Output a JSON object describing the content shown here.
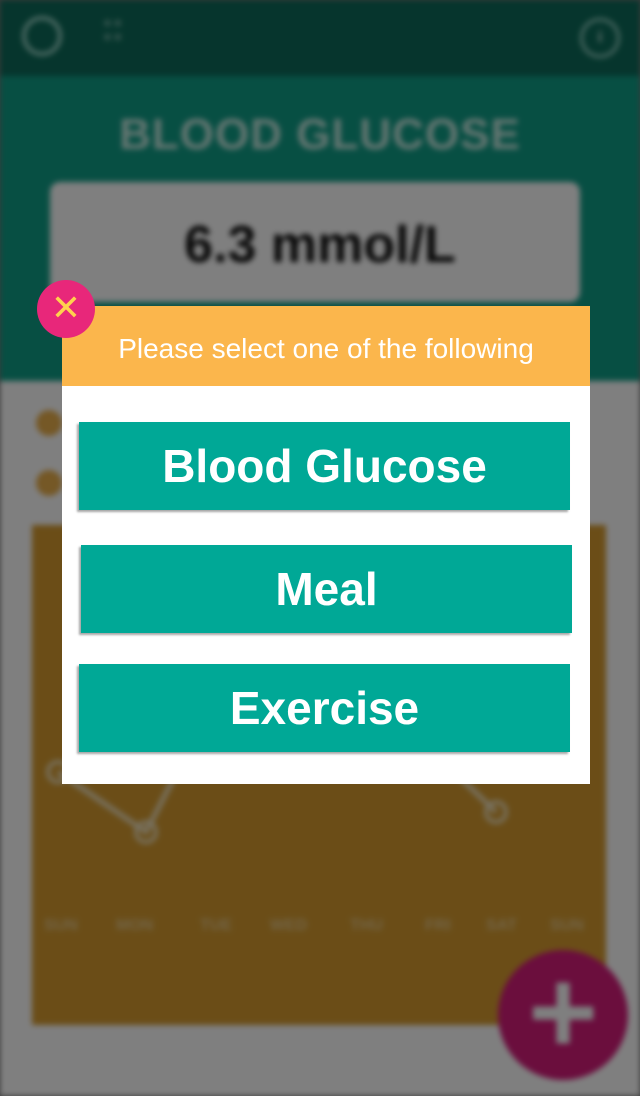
{
  "app": {
    "topbar": {
      "menu_label_top": "≡ ≡",
      "menu_label_bottom": "≡ ≡",
      "info_glyph": "i",
      "settings_icon": "gear-icon"
    },
    "hero": {
      "title": "BLOOD GLUCOSE",
      "reading": "6.3 mmol/L"
    },
    "chart_days": [
      "SUN",
      "MON",
      "TUE",
      "WED",
      "THU",
      "FRI",
      "SAT",
      "SUN"
    ],
    "fab": {
      "icon": "plus-icon",
      "glyph": "+"
    }
  },
  "dialog": {
    "title": "Please select one of the following",
    "close_glyph": "✕",
    "options": [
      {
        "label": "Blood Glucose"
      },
      {
        "label": "Meal"
      },
      {
        "label": "Exercise"
      }
    ]
  },
  "colors": {
    "teal": "#00a896",
    "header_orange": "#fbb64c",
    "close_pink": "#e8277a",
    "close_x": "#ffd24d"
  }
}
